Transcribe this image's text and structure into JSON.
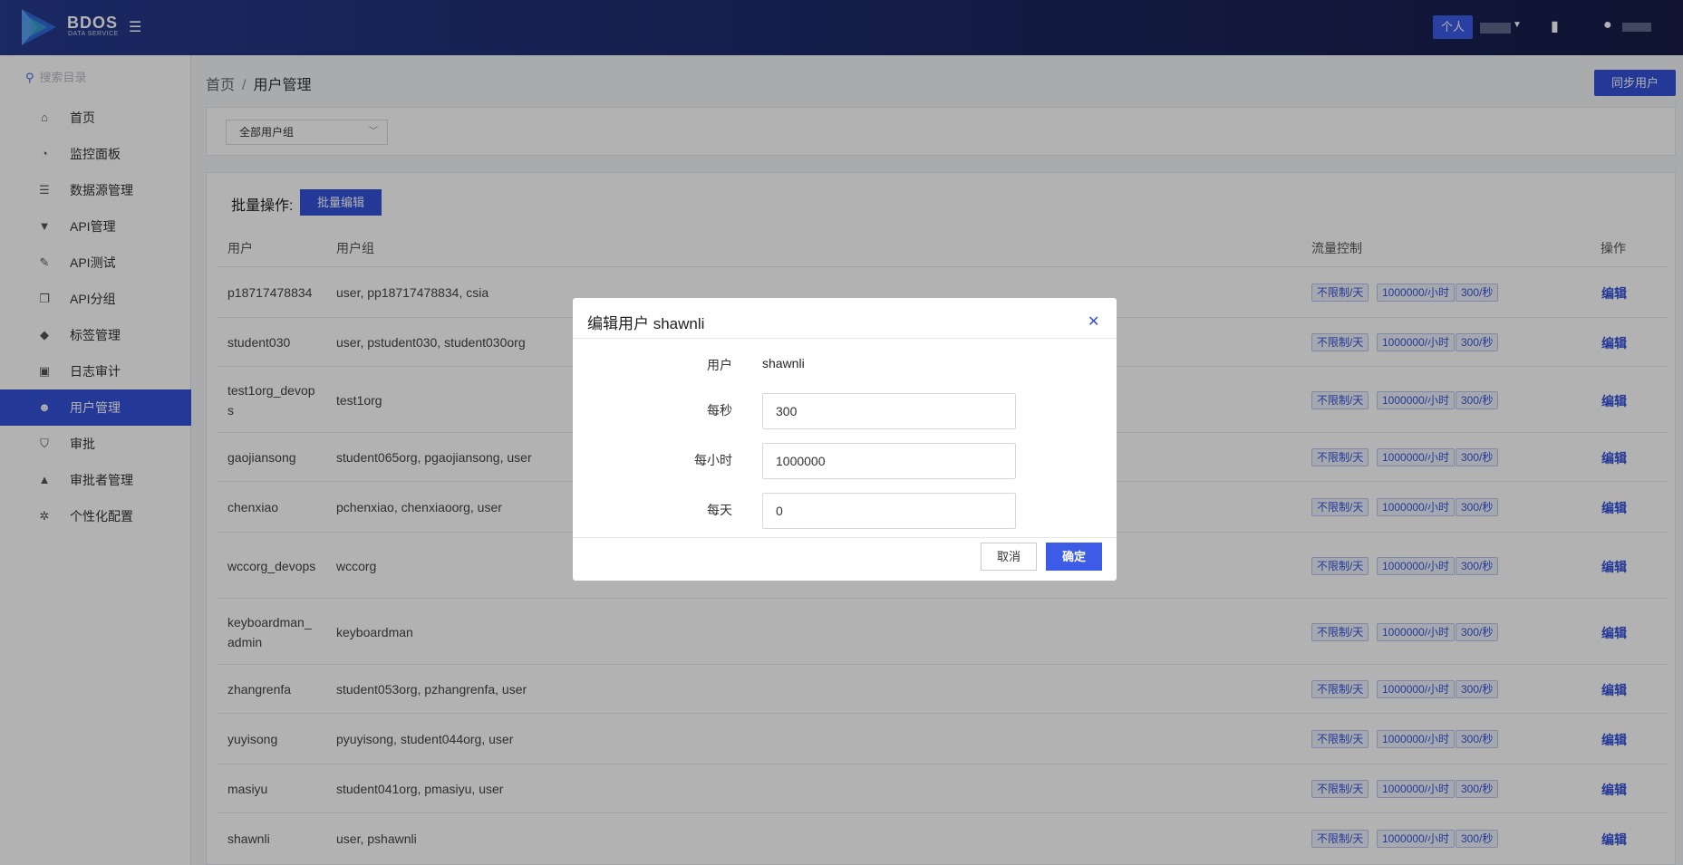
{
  "header": {
    "logo_text": "BDOS",
    "logo_sub": "DATA SERVICE",
    "personal_button": "个人"
  },
  "sidebar": {
    "search_placeholder": "搜索目录",
    "items": [
      {
        "label": "首页",
        "icon": "home-icon"
      },
      {
        "label": "监控面板",
        "icon": "dashboard-icon"
      },
      {
        "label": "数据源管理",
        "icon": "database-icon"
      },
      {
        "label": "API管理",
        "icon": "filter-icon"
      },
      {
        "label": "API测试",
        "icon": "pencil-icon"
      },
      {
        "label": "API分组",
        "icon": "group-icon"
      },
      {
        "label": "标签管理",
        "icon": "tags-icon"
      },
      {
        "label": "日志审计",
        "icon": "log-icon"
      },
      {
        "label": "用户管理",
        "icon": "users-icon",
        "active": true
      },
      {
        "label": "审批",
        "icon": "shield-icon"
      },
      {
        "label": "审批者管理",
        "icon": "lock-icon"
      },
      {
        "label": "个性化配置",
        "icon": "gear-icon"
      }
    ]
  },
  "breadcrumb": {
    "home": "首页",
    "separator": "/",
    "current": "用户管理"
  },
  "sync_button": "同步用户",
  "filter": {
    "group_select": "全部用户组"
  },
  "batch": {
    "label": "批量操作:",
    "button": "批量编辑"
  },
  "table": {
    "headers": {
      "user": "用户",
      "group": "用户组",
      "flow": "流量控制",
      "action": "操作"
    },
    "flow_tags": [
      "不限制/天",
      "1000000/小时",
      "300/秒"
    ],
    "edit_label": "编辑",
    "rows": [
      {
        "user": "p18717478834",
        "groups": "user, pp18717478834, csia"
      },
      {
        "user": "student030",
        "groups": "user, pstudent030, student030org"
      },
      {
        "user": "test1org_devops",
        "groups": "test1org"
      },
      {
        "user": "gaojiansong",
        "groups": "student065org, pgaojiansong, user"
      },
      {
        "user": "chenxiao",
        "groups": "pchenxiao, chenxiaoorg, user"
      },
      {
        "user": "wccorg_devops",
        "groups": "wccorg"
      },
      {
        "user": "keyboardman_admin",
        "groups": "keyboardman"
      },
      {
        "user": "zhangrenfa",
        "groups": "student053org, pzhangrenfa, user"
      },
      {
        "user": "yuyisong",
        "groups": "pyuyisong, student044org, user"
      },
      {
        "user": "masiyu",
        "groups": "student041org, pmasiyu, user"
      },
      {
        "user": "shawnli",
        "groups": "user, pshawnli"
      }
    ]
  },
  "modal": {
    "title": "编辑用户 shawnli",
    "fields": {
      "user_label": "用户",
      "user_value": "shawnli",
      "per_second_label": "每秒",
      "per_second_value": "300",
      "per_hour_label": "每小时",
      "per_hour_value": "1000000",
      "per_day_label": "每天",
      "per_day_value": "0"
    },
    "cancel": "取消",
    "confirm": "确定"
  }
}
